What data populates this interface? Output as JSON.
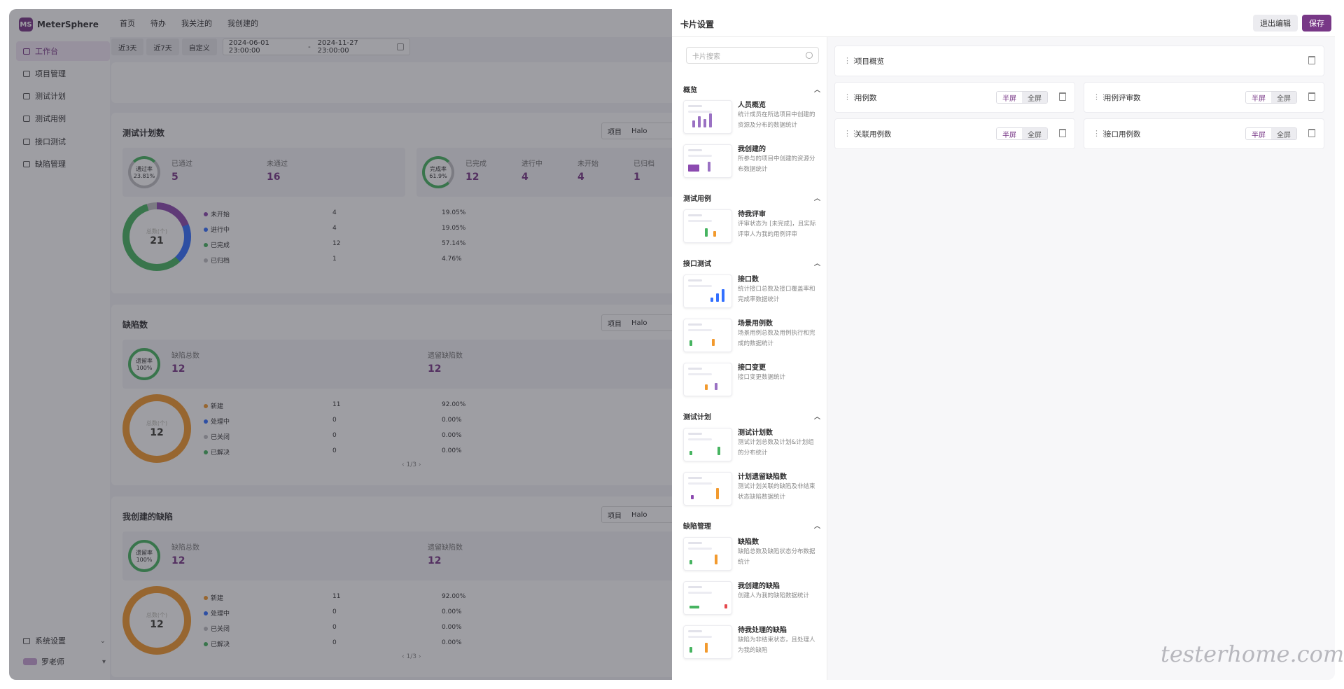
{
  "app": {
    "name": "MeterSphere",
    "logo_mark": "MS"
  },
  "sidebar": {
    "items": [
      {
        "label": "工作台",
        "active": true
      },
      {
        "label": "项目管理"
      },
      {
        "label": "测试计划"
      },
      {
        "label": "测试用例"
      },
      {
        "label": "接口测试"
      },
      {
        "label": "缺陷管理"
      }
    ],
    "settings_label": "系统设置",
    "user_label": "罗老师"
  },
  "topnav": [
    "首页",
    "待办",
    "我关注的",
    "我创建的"
  ],
  "filters": {
    "quick": [
      "近3天",
      "近7天",
      "自定义"
    ],
    "start": "2024-06-01 23:00:00",
    "sep": "-",
    "end": "2024-11-27 23:00:00"
  },
  "cards": [
    {
      "title": "测试计划数",
      "project_label": "项目",
      "project": "Halo",
      "ring_label": "通过率",
      "ring_value": "23.81%",
      "stats": [
        {
          "label": "已通过",
          "value": "5"
        },
        {
          "label": "未通过",
          "value": "16"
        }
      ],
      "ring2_label": "完成率",
      "ring2_value": "61.9%",
      "stats2": [
        {
          "label": "已完成",
          "value": "12"
        },
        {
          "label": "进行中",
          "value": "4"
        },
        {
          "label": "未开始",
          "value": "4"
        },
        {
          "label": "已归档",
          "value": "1"
        }
      ],
      "total_label": "总数(个)",
      "total": "21",
      "legend": [
        {
          "name": "未开始",
          "count": "4",
          "pct": "19.05%",
          "color": "#8c4ab0"
        },
        {
          "name": "进行中",
          "count": "4",
          "pct": "19.05%",
          "color": "#3370ff"
        },
        {
          "name": "已完成",
          "count": "12",
          "pct": "57.14%",
          "color": "#47b461"
        },
        {
          "name": "已归档",
          "count": "1",
          "pct": "4.76%",
          "color": "#bfbfc4"
        }
      ]
    },
    {
      "title": "缺陷数",
      "project_label": "项目",
      "project": "Halo",
      "ring_label": "遗留率",
      "ring_value": "100%",
      "stats": [
        {
          "label": "缺陷总数",
          "value": "12"
        },
        {
          "label": "遗留缺陷数",
          "value": "12"
        }
      ],
      "total_label": "总数(个)",
      "total": "12",
      "legend": [
        {
          "name": "新建",
          "count": "11",
          "pct": "92.00%",
          "color": "#f29a2e"
        },
        {
          "name": "处理中",
          "count": "0",
          "pct": "0.00%",
          "color": "#3370ff"
        },
        {
          "name": "已关闭",
          "count": "0",
          "pct": "0.00%",
          "color": "#bfbfc4"
        },
        {
          "name": "已解决",
          "count": "0",
          "pct": "0.00%",
          "color": "#47b461"
        }
      ],
      "pager": "1/3"
    },
    {
      "title": "我创建的缺陷",
      "project_label": "项目",
      "project": "Halo",
      "ring_label": "遗留率",
      "ring_value": "100%",
      "stats": [
        {
          "label": "缺陷总数",
          "value": "12"
        },
        {
          "label": "遗留缺陷数",
          "value": "12"
        }
      ],
      "total_label": "总数(个)",
      "total": "12",
      "legend": [
        {
          "name": "新建",
          "count": "11",
          "pct": "92.00%",
          "color": "#f29a2e"
        },
        {
          "name": "处理中",
          "count": "0",
          "pct": "0.00%",
          "color": "#3370ff"
        },
        {
          "name": "已关闭",
          "count": "0",
          "pct": "0.00%",
          "color": "#bfbfc4"
        },
        {
          "name": "已解决",
          "count": "0",
          "pct": "0.00%",
          "color": "#47b461"
        }
      ],
      "pager": "1/3"
    }
  ],
  "drawer": {
    "title": "卡片设置",
    "exit_label": "退出编辑",
    "save_label": "保存",
    "search_placeholder": "卡片搜索",
    "sections": [
      {
        "name": "概览",
        "items": [
          {
            "title": "人员概览",
            "desc": "统计成员在所选项目中创建的资源及分布的数据统计"
          },
          {
            "title": "我创建的",
            "desc": "所参与的项目中创建的资源分布数据统计"
          }
        ]
      },
      {
        "name": "测试用例",
        "items": [
          {
            "title": "待我评审",
            "desc": "评审状态为 [未完成]，且实际评审人为我的用例评审"
          }
        ]
      },
      {
        "name": "接口测试",
        "items": [
          {
            "title": "接口数",
            "desc": "统计接口总数及接口覆盖率和完成率数据统计"
          },
          {
            "title": "场景用例数",
            "desc": "场景用例总数及用例执行和完成的数据统计"
          },
          {
            "title": "接口变更",
            "desc": "接口变更数据统计"
          }
        ]
      },
      {
        "name": "测试计划",
        "items": [
          {
            "title": "测试计划数",
            "desc": "测试计划总数及计划&计划组的分布统计"
          },
          {
            "title": "计划遗留缺陷数",
            "desc": "测试计划关联的缺陷及非结束状态缺陷数据统计"
          }
        ]
      },
      {
        "name": "缺陷管理",
        "items": [
          {
            "title": "缺陷数",
            "desc": "缺陷总数及缺陷状态分布数据统计"
          },
          {
            "title": "我创建的缺陷",
            "desc": "创建人为我的缺陷数据统计"
          },
          {
            "title": "待我处理的缺陷",
            "desc": "缺陷为非结束状态，且处理人为我的缺陷"
          }
        ]
      }
    ],
    "layout": {
      "half_label": "半屏",
      "full_label": "全屏",
      "cards": [
        {
          "name": "项目概览",
          "size": "full"
        },
        {
          "name": "用例数",
          "size": "half"
        },
        {
          "name": "用例评审数",
          "size": "half"
        },
        {
          "name": "关联用例数",
          "size": "half"
        },
        {
          "name": "接口用例数",
          "size": "half"
        }
      ]
    }
  },
  "watermark": "testerhome.com"
}
